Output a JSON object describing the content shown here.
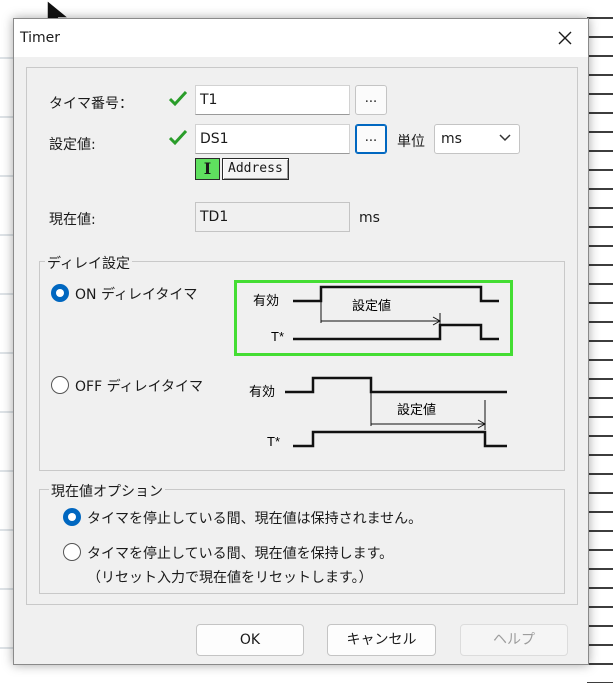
{
  "dialog": {
    "title": "Timer",
    "timer_number": {
      "label": "タイマ番号：",
      "value": "T1",
      "browse_label": "..."
    },
    "setpoint": {
      "label": "設定値:",
      "value": "DS1",
      "browse_label": "...",
      "unit_label": "単位",
      "unit_value": "ms",
      "i_icon": "I",
      "address_tag": "Address"
    },
    "current_value": {
      "label": "現在値:",
      "value": "TD1",
      "unit": "ms"
    },
    "delay_group": {
      "title": "ディレイ設定",
      "on_delay": {
        "label": "ON ディレイタイマ",
        "checked": true,
        "diagram": {
          "enable_label": "有効",
          "setpoint_label": "設定値",
          "output_label": "T*"
        }
      },
      "off_delay": {
        "label": "OFF ディレイタイマ",
        "checked": false,
        "diagram": {
          "enable_label": "有効",
          "setpoint_label": "設定値",
          "output_label": "T*"
        }
      }
    },
    "current_option_group": {
      "title": "現在値オプション",
      "option1": {
        "label": "タイマを停止している間、現在値は保持されません。",
        "checked": true
      },
      "option2": {
        "label": "タイマを停止している間、現在値を保持します。",
        "sublabel": "（リセット入力で現在値をリセットします。）",
        "checked": false
      }
    },
    "buttons": {
      "ok": "OK",
      "cancel": "キャンセル",
      "help": "ヘルプ"
    }
  },
  "colors": {
    "accent": "#0067c0",
    "check_green": "#2a9d2a",
    "selection_green": "#44dd33",
    "i_icon_green": "#5fe05f"
  },
  "icons": [
    "cursor-arrow-icon",
    "close-icon",
    "checkmark-icon",
    "chevron-down-icon",
    "i-beam-icon"
  ]
}
